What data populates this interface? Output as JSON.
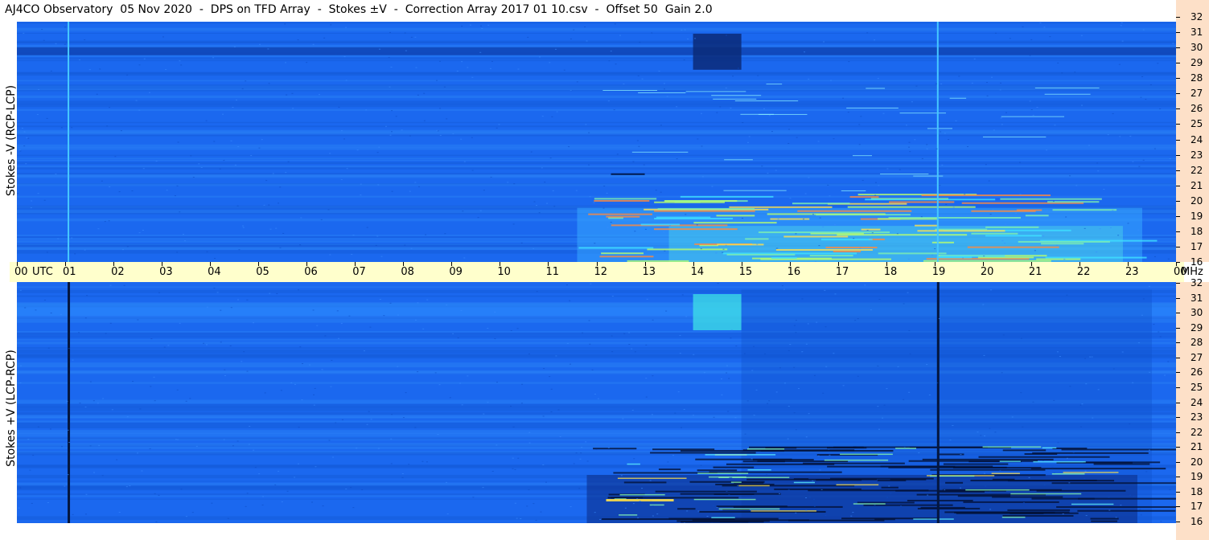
{
  "title": "AJ4CO Observatory  05 Nov 2020  -  DPS on TFD Array  -  Stokes ±V  -  Correction Array 2017 01 10.csv  -  Offset 50  Gain 2.0",
  "chart_data": {
    "type": "heatmap",
    "panels": [
      {
        "ylabel": "Stokes -V (RCP-LCP)"
      },
      {
        "ylabel": "Stokes +V (LCP-RCP)"
      }
    ],
    "x_ticks": [
      "00",
      "01",
      "02",
      "03",
      "04",
      "05",
      "06",
      "07",
      "08",
      "09",
      "10",
      "11",
      "12",
      "13",
      "14",
      "15",
      "16",
      "17",
      "18",
      "19",
      "20",
      "21",
      "22",
      "23",
      "00"
    ],
    "x_unit": "UTC",
    "y_ticks": [
      32,
      31,
      30,
      29,
      28,
      27,
      26,
      25,
      24,
      23,
      22,
      21,
      20,
      19,
      18,
      17,
      16
    ],
    "y_unit": "MHz",
    "ylim": [
      16,
      32
    ],
    "xlim_hours": [
      0,
      24
    ],
    "colors": {
      "background_blue": "#1a66f0",
      "axis_band": "#ffffcc",
      "tick_strip": "#fde0c8"
    }
  }
}
